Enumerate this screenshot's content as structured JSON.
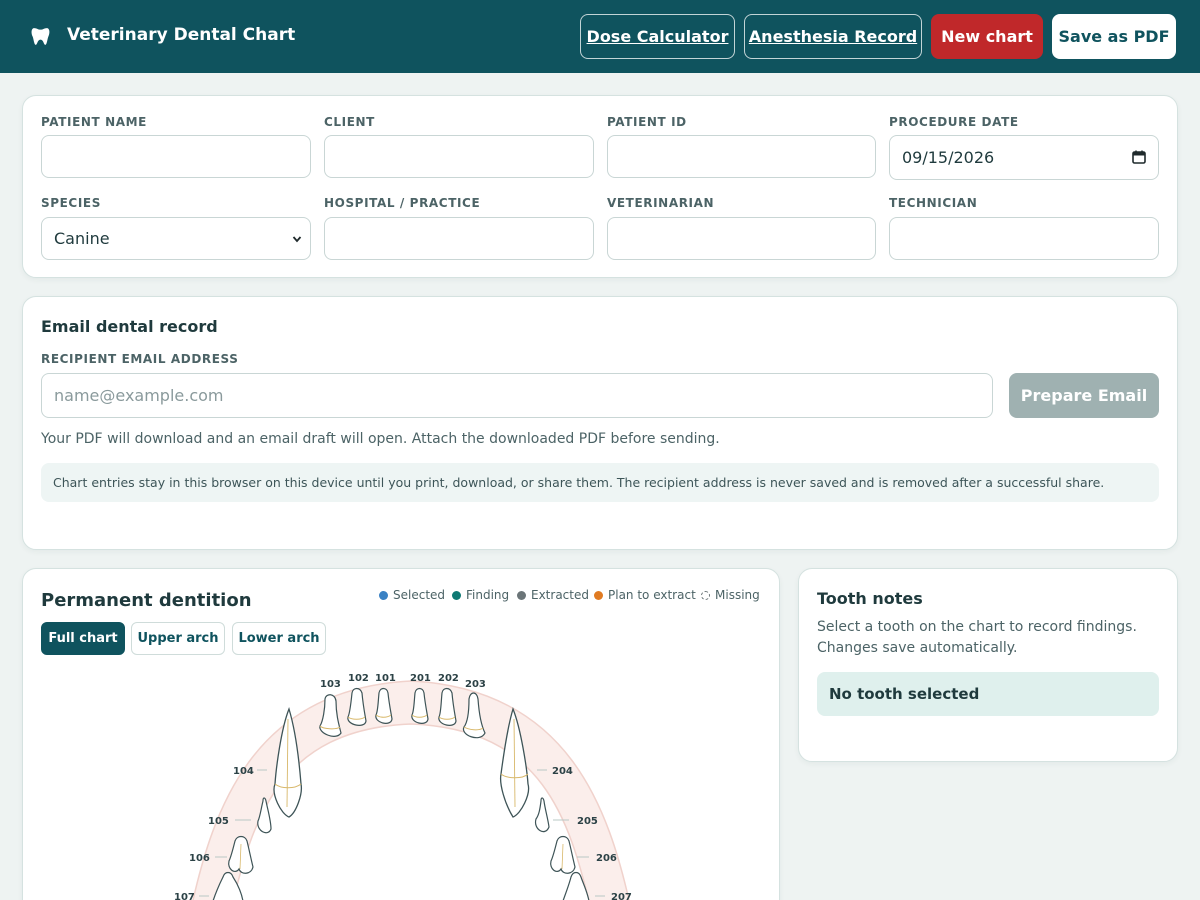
{
  "header": {
    "title": "Veterinary Dental Chart",
    "buttons": {
      "dose": "Dose Calculator",
      "anesthesia": "Anesthesia Record",
      "new_chart": "New chart",
      "save_pdf": "Save as PDF"
    }
  },
  "patient_form": {
    "patient_name": {
      "label": "PATIENT NAME",
      "value": ""
    },
    "client": {
      "label": "CLIENT",
      "value": ""
    },
    "patient_id": {
      "label": "PATIENT ID",
      "value": ""
    },
    "procedure_date": {
      "label": "PROCEDURE DATE",
      "value": "09/15/2026"
    },
    "species": {
      "label": "SPECIES",
      "value": "Canine"
    },
    "hospital": {
      "label": "HOSPITAL / PRACTICE",
      "value": ""
    },
    "veterinarian": {
      "label": "VETERINARIAN",
      "value": ""
    },
    "technician": {
      "label": "TECHNICIAN",
      "value": ""
    }
  },
  "email": {
    "title": "Email dental record",
    "recipient_label": "RECIPIENT EMAIL ADDRESS",
    "recipient_placeholder": "name@example.com",
    "prepare_button": "Prepare Email",
    "helper": "Your PDF will download and an email draft will open. Attach the downloaded PDF before sending.",
    "privacy_note": "Chart entries stay in this browser on this device until you print, download, or share them. The recipient address is never saved and is removed after a successful share."
  },
  "dentition": {
    "title": "Permanent dentition",
    "legend": [
      {
        "label": "Selected",
        "color": "#3b82c4"
      },
      {
        "label": "Finding",
        "color": "#0f7a74"
      },
      {
        "label": "Extracted",
        "color": "#6b7578"
      },
      {
        "label": "Plan to extract",
        "color": "#e07b22"
      },
      {
        "label": "Missing",
        "color": "none"
      }
    ],
    "tabs": [
      "Full chart",
      "Upper arch",
      "Lower arch"
    ],
    "active_tab": "Full chart",
    "tooth_labels": {
      "t103": "103",
      "t102": "102",
      "t101": "101",
      "t201": "201",
      "t202": "202",
      "t203": "203",
      "t104": "104",
      "t105": "105",
      "t106": "106",
      "t107": "107",
      "t204": "204",
      "t205": "205",
      "t206": "206",
      "t207": "207"
    }
  },
  "tooth_notes": {
    "title": "Tooth notes",
    "help": "Select a tooth on the chart to record findings. Changes save automatically.",
    "empty_state": "No tooth selected"
  },
  "colors": {
    "brand": "#0f535e",
    "danger": "#c0282a",
    "arch_fill": "#fbeeeb"
  }
}
